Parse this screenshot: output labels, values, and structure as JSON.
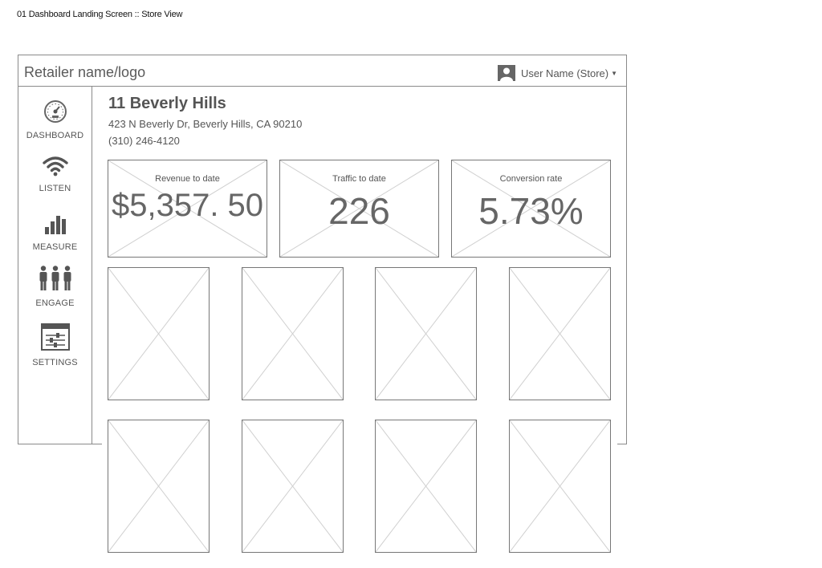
{
  "caption": "01 Dashboard Landing Screen :: Store View",
  "header": {
    "brand": "Retailer name/logo",
    "user_name": "User Name (Store)",
    "user_icon": "user-avatar-icon",
    "caret_icon": "caret-down-icon"
  },
  "sidebar": {
    "items": [
      {
        "label": "DASHBOARD",
        "icon": "speedometer-icon"
      },
      {
        "label": "LISTEN",
        "icon": "wifi-icon"
      },
      {
        "label": "MEASURE",
        "icon": "bar-chart-icon"
      },
      {
        "label": "ENGAGE",
        "icon": "people-icon"
      },
      {
        "label": "SETTINGS",
        "icon": "sliders-icon"
      }
    ]
  },
  "store": {
    "name": "11 Beverly Hills",
    "address": "423 N Beverly Dr, Beverly Hills, CA 90210",
    "phone": "(310) 246-4120"
  },
  "kpis": [
    {
      "label": "Revenue to date",
      "value": "$5,357. 50"
    },
    {
      "label": "Traffic to date",
      "value": "226"
    },
    {
      "label": "Conversion rate",
      "value": "5.73%"
    }
  ],
  "colors": {
    "ink": "#555555",
    "border": "#777777",
    "placeholder_cross": "#d0d0d0"
  }
}
